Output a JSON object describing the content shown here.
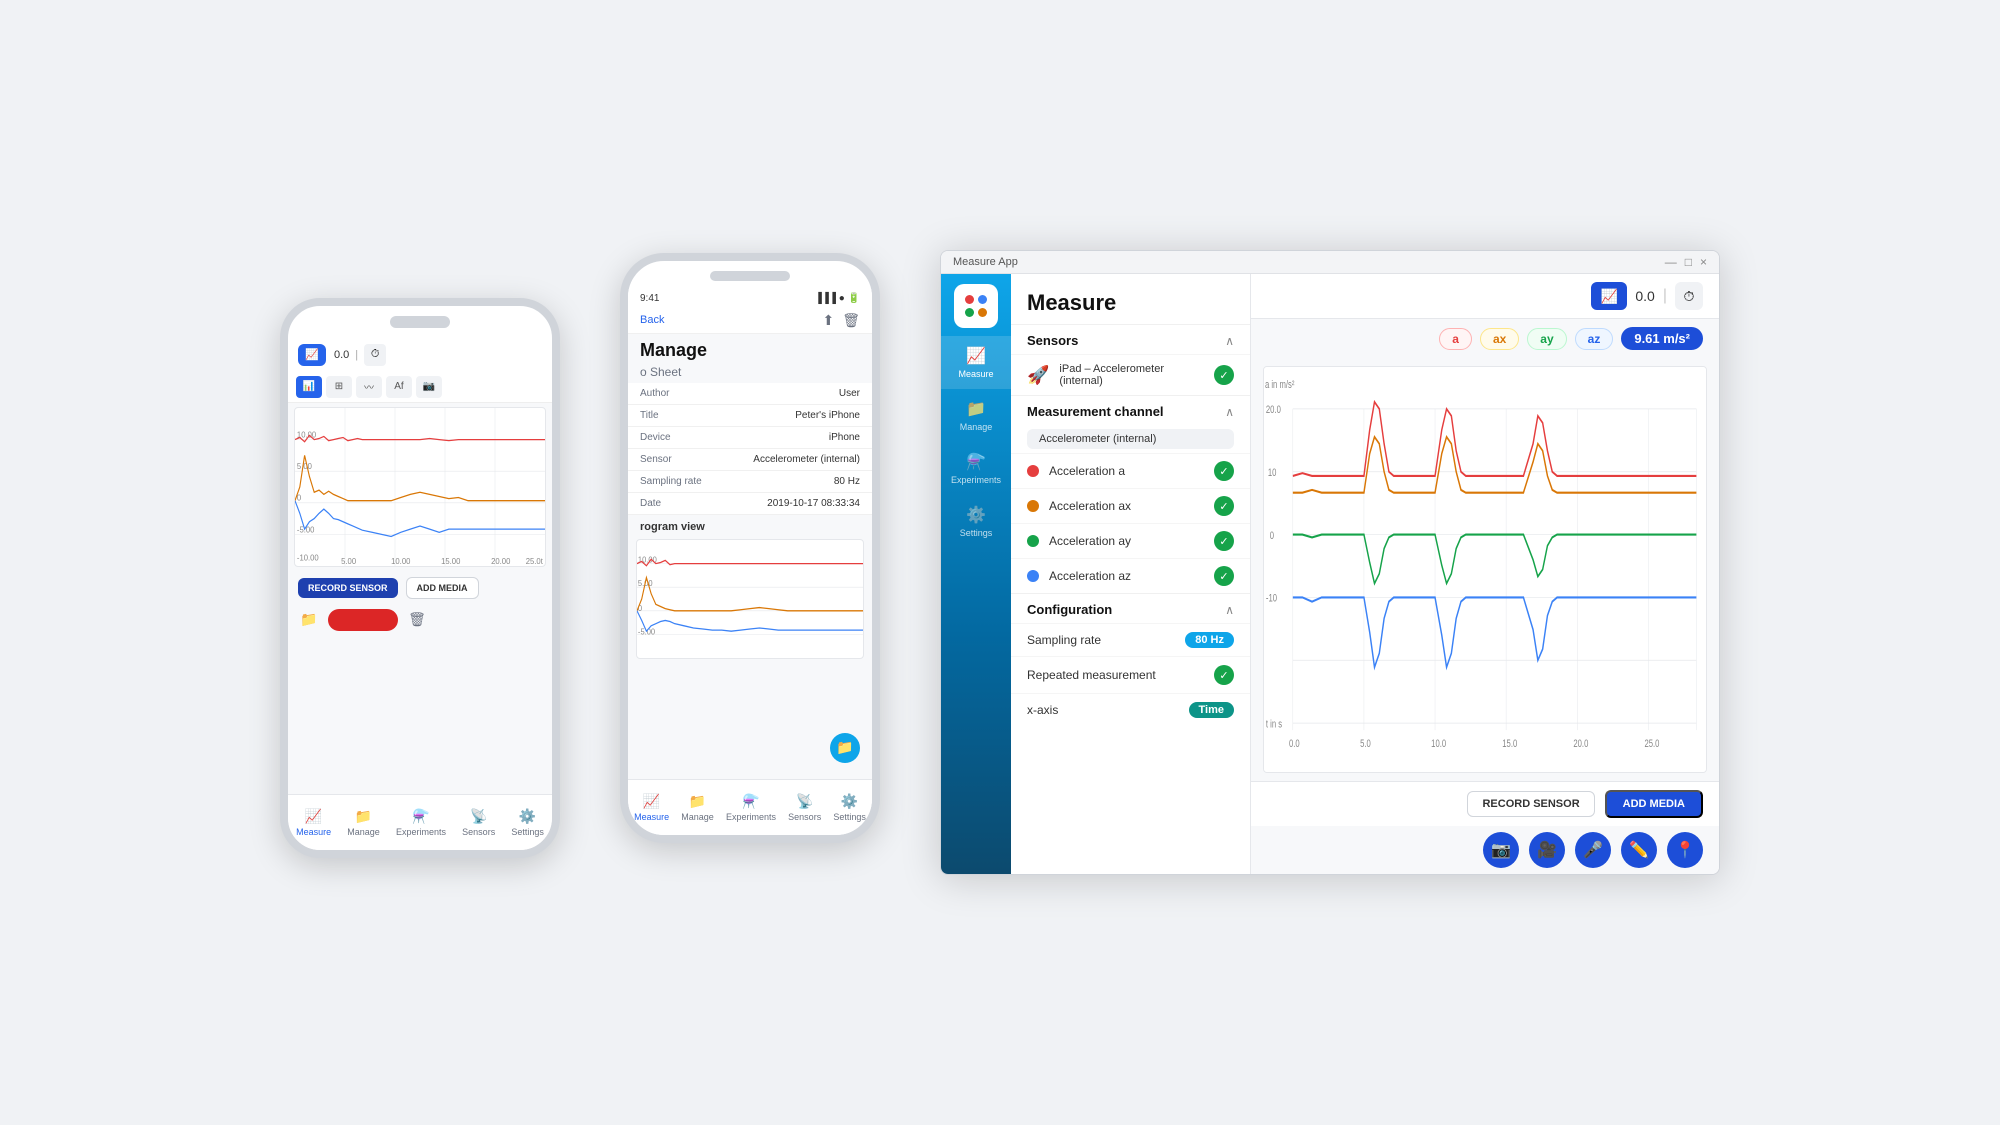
{
  "app": {
    "title": "Measure App",
    "window_controls": [
      "—",
      "□",
      "×"
    ]
  },
  "phone_left": {
    "value": "0.0",
    "record_sensor": "RECORD SENSOR",
    "add_media": "ADD MEDIA",
    "nav_items": [
      {
        "label": "Measure",
        "icon": "📈"
      },
      {
        "label": "Manage",
        "icon": "📁"
      },
      {
        "label": "Experiments",
        "icon": "⚗️"
      },
      {
        "label": "Sensors",
        "icon": "📡"
      },
      {
        "label": "Settings",
        "icon": "⚙️"
      }
    ]
  },
  "phone_mid": {
    "time": "9:41",
    "back_label": "Back",
    "title": "Manage",
    "subtitle": "o Sheet",
    "info_rows": [
      {
        "label": "Author",
        "value": "User"
      },
      {
        "label": "Title",
        "value": "Peter's iPhone"
      },
      {
        "label": "Device",
        "value": "iPhone"
      },
      {
        "label": "Sensor",
        "value": "Accelerometer (internal)"
      },
      {
        "label": "Sampling rate",
        "value": "80 Hz"
      },
      {
        "label": "Date",
        "value": "2019-10-17 08:33:34"
      }
    ],
    "diagram_label": "rogram view",
    "nav_items": [
      {
        "label": "Measure",
        "icon": "📈"
      },
      {
        "label": "Manage",
        "icon": "📁"
      },
      {
        "label": "Experiments",
        "icon": "⚗️"
      },
      {
        "label": "Sensors",
        "icon": "📡"
      },
      {
        "label": "Settings",
        "icon": "⚙️"
      }
    ]
  },
  "desktop": {
    "title": "Measure App",
    "sidebar_items": [
      {
        "label": "Measure",
        "icon": "📈",
        "active": true
      },
      {
        "label": "Manage",
        "icon": "📁"
      },
      {
        "label": "Experiments",
        "icon": "⚗️"
      },
      {
        "label": "Settings",
        "icon": "⚙️"
      }
    ],
    "panel_title": "Measure",
    "sensors_section": "Sensors",
    "sensor_name": "iPad – Accelerometer (internal)",
    "measurement_channel": "Measurement channel",
    "channel_tag": "Accelerometer (internal)",
    "channels": [
      {
        "label": "Acceleration a",
        "color": "#e53e3e"
      },
      {
        "label": "Acceleration ax",
        "color": "#d97706"
      },
      {
        "label": "Acceleration ay",
        "color": "#16a34a"
      },
      {
        "label": "Acceleration az",
        "color": "#3b82f6"
      }
    ],
    "configuration": "Configuration",
    "config_rows": [
      {
        "label": "Sampling rate",
        "value": "80 Hz",
        "type": "badge-blue"
      },
      {
        "label": "Repeated measurement",
        "value": "✓",
        "type": "check"
      },
      {
        "label": "x-axis",
        "value": "Time",
        "type": "badge-teal"
      }
    ],
    "value_display": "0.0",
    "accel_tabs": [
      "a",
      "ax",
      "ay",
      "az",
      "9.61 m/s²"
    ],
    "record_sensor": "RECORD SENSOR",
    "add_media": "ADD MEDIA"
  },
  "colors": {
    "red": "#e53e3e",
    "orange": "#d97706",
    "green": "#16a34a",
    "blue": "#3b82f6",
    "dark_blue": "#1d4ed8",
    "teal": "#0ea5e9"
  }
}
